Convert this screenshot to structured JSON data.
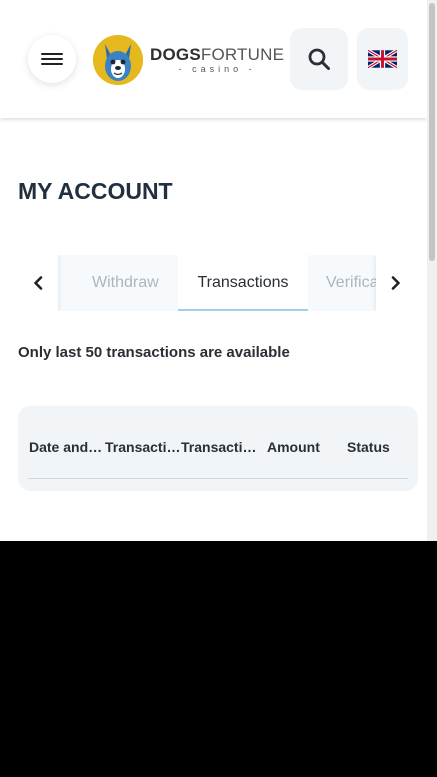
{
  "header": {
    "brand_bold": "DOGS",
    "brand_light": "FORTUNE",
    "brand_sub": "casino",
    "icons": {
      "menu": "hamburger-menu-icon",
      "search": "search-icon",
      "language": "uk-flag-icon",
      "logo": "french-bulldog-logo"
    }
  },
  "page": {
    "title": "MY ACCOUNT",
    "notice": "Only last 50 transactions are available"
  },
  "tabs": {
    "items": [
      {
        "label": "Withdraw",
        "active": false
      },
      {
        "label": "Transactions",
        "active": true
      },
      {
        "label": "Verifica",
        "active": false
      }
    ],
    "prev_icon": "chevron-left-icon",
    "next_icon": "chevron-right-icon"
  },
  "table": {
    "columns": [
      "Date and …",
      "Transacti…",
      "Transacti…",
      "Amount",
      "Status"
    ]
  },
  "colors": {
    "accent_underline": "#9ed0ec",
    "heading": "#21303f",
    "logo_yellow": "#e5b81d",
    "button_bg": "#f1f5f8"
  }
}
